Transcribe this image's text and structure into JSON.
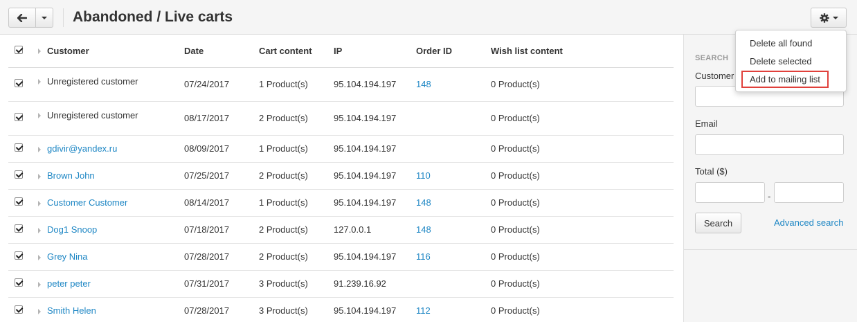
{
  "header": {
    "title": "Abandoned / Live carts"
  },
  "table": {
    "columns": [
      "Customer",
      "Date",
      "Cart content",
      "IP",
      "Order ID",
      "Wish list content"
    ],
    "rows": [
      {
        "customer": "Unregistered customer",
        "date": "07/24/2017",
        "cart": "1 Product(s)",
        "ip": "95.104.194.197",
        "order_id": "148",
        "wishlist": "0 Product(s)"
      },
      {
        "customer": "Unregistered customer",
        "date": "08/17/2017",
        "cart": "2 Product(s)",
        "ip": "95.104.194.197",
        "order_id": "",
        "wishlist": "0 Product(s)"
      },
      {
        "customer": "gdivir@yandex.ru",
        "date": "08/09/2017",
        "cart": "1 Product(s)",
        "ip": "95.104.194.197",
        "order_id": "",
        "wishlist": "0 Product(s)"
      },
      {
        "customer": "Brown John",
        "date": "07/25/2017",
        "cart": "2 Product(s)",
        "ip": "95.104.194.197",
        "order_id": "110",
        "wishlist": "0 Product(s)"
      },
      {
        "customer": "Customer Customer",
        "date": "08/14/2017",
        "cart": "1 Product(s)",
        "ip": "95.104.194.197",
        "order_id": "148",
        "wishlist": "0 Product(s)"
      },
      {
        "customer": "Dog1 Snoop",
        "date": "07/18/2017",
        "cart": "2 Product(s)",
        "ip": "127.0.0.1",
        "order_id": "148",
        "wishlist": "0 Product(s)"
      },
      {
        "customer": "Grey Nina",
        "date": "07/28/2017",
        "cart": "2 Product(s)",
        "ip": "95.104.194.197",
        "order_id": "116",
        "wishlist": "0 Product(s)"
      },
      {
        "customer": "peter peter",
        "date": "07/31/2017",
        "cart": "3 Product(s)",
        "ip": "91.239.16.92",
        "order_id": "",
        "wishlist": "0 Product(s)"
      },
      {
        "customer": "Smith Helen",
        "date": "07/28/2017",
        "cart": "3 Product(s)",
        "ip": "95.104.194.197",
        "order_id": "112",
        "wishlist": "0 Product(s)"
      }
    ]
  },
  "sidebar": {
    "title": "SEARCH",
    "customer_label": "Customer",
    "email_label": "Email",
    "total_label": "Total ($)",
    "dash": "-",
    "search_button": "Search",
    "advanced_search": "Advanced search"
  },
  "dropdown": {
    "items": [
      "Delete all found",
      "Delete selected",
      "Add to mailing list"
    ]
  },
  "icons": {
    "back": "arrow-left-icon",
    "gear": "gear-icon",
    "caret": "caret-down-icon",
    "expand": "triangle-right-icon",
    "checkbox": "checkbox-checked-icon"
  },
  "colors": {
    "link": "#1d86c4",
    "highlight": "#e0403b"
  }
}
